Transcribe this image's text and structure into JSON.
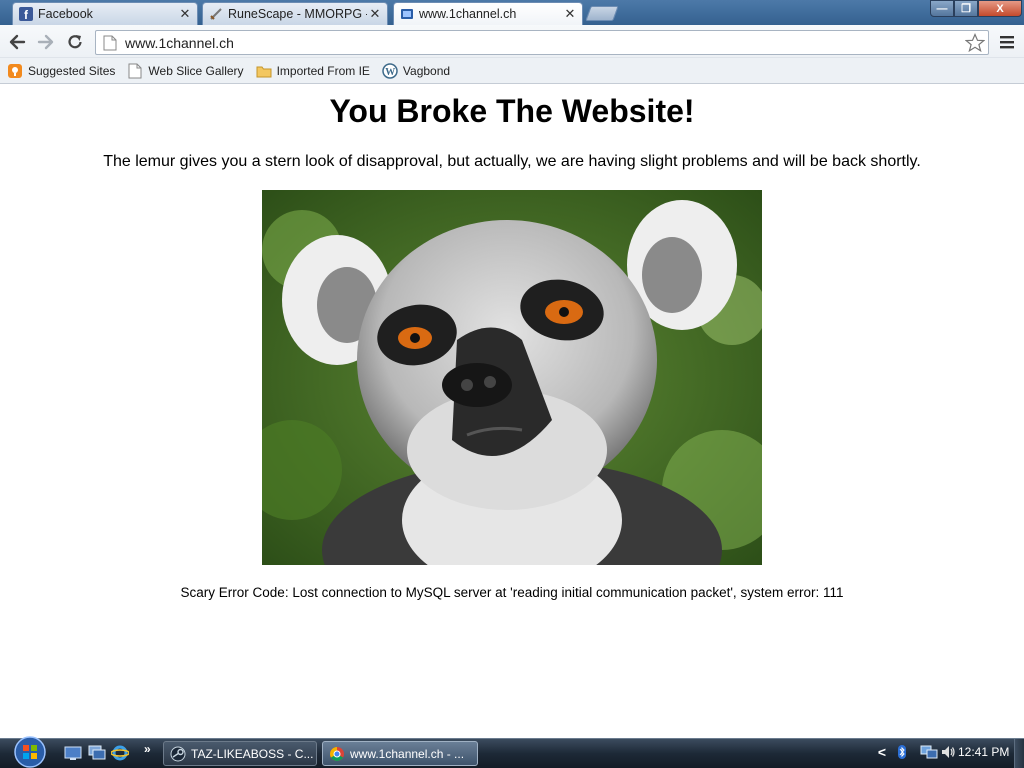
{
  "browser": {
    "tabs": [
      {
        "title": "Facebook",
        "favicon": "facebook-icon",
        "active": false
      },
      {
        "title": "RuneScape - MMORPG - T",
        "favicon": "sword-icon",
        "active": false
      },
      {
        "title": "www.1channel.ch",
        "favicon": "film-icon",
        "active": true
      }
    ],
    "address": "www.1channel.ch",
    "bookmarks": [
      {
        "label": "Suggested Sites",
        "icon": "suggested-sites-icon"
      },
      {
        "label": "Web Slice Gallery",
        "icon": "page-icon"
      },
      {
        "label": "Imported From IE",
        "icon": "folder-icon"
      },
      {
        "label": "Vagbond",
        "icon": "wordpress-icon"
      }
    ],
    "window_controls": {
      "minimize": "—",
      "maximize": "❐",
      "close": "X"
    }
  },
  "page": {
    "title": "You Broke The Website!",
    "subtitle": "The lemur gives you a stern look of disapproval, but actually, we are having slight problems and will be back shortly.",
    "error_code": "Scary Error Code: Lost connection to MySQL server at 'reading initial communication packet', system error: 111"
  },
  "taskbar": {
    "tasks": [
      {
        "label": "TAZ-LIKEABOSS - C...",
        "icon": "steam-icon",
        "active": false
      },
      {
        "label": "www.1channel.ch - ...",
        "icon": "chrome-icon",
        "active": true
      }
    ],
    "quick_launch_more": "»",
    "tray_chevron": "<",
    "clock": "12:41 PM"
  },
  "colors": {
    "tabstrip": "#3e6b9a",
    "toolbar": "#edf1f5",
    "taskbar": "#1d2937"
  }
}
